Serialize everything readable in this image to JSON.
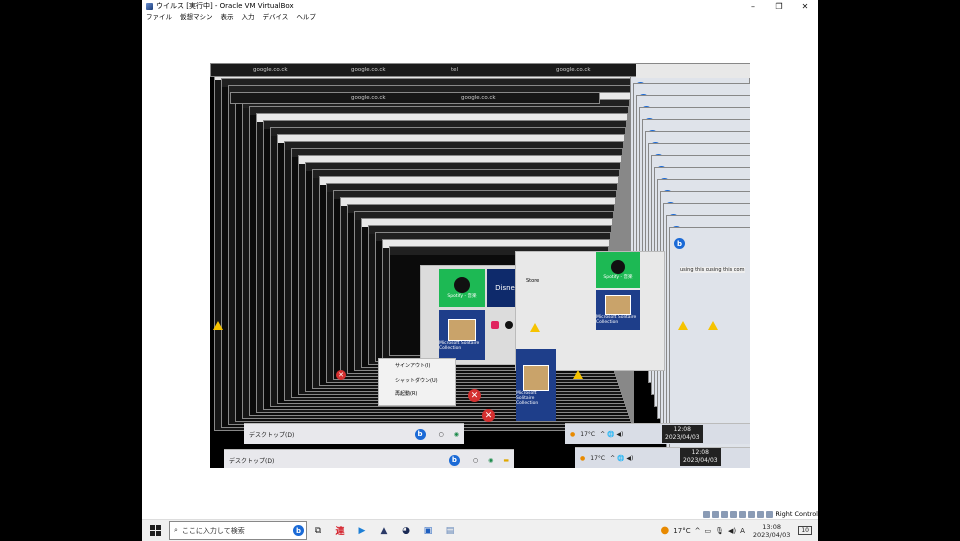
{
  "window": {
    "title": "ウイルス [実行中] - Oracle VM VirtualBox",
    "minimize_glyph": "–",
    "maximize_glyph": "❐",
    "close_glyph": "✕"
  },
  "menu": [
    "ファイル",
    "仮想マシン",
    "表示",
    "入力",
    "デバイス",
    "ヘルプ"
  ],
  "guest": {
    "tabs": [
      "google.co.ck",
      "google.co.ck",
      "google.co.ck",
      "google.co.ck",
      "google.co.ck",
      "tel"
    ],
    "start_tiles": [
      "Spotify - 音楽",
      "Disney+",
      "Microsoft Solitaire Collection"
    ],
    "menu_items": [
      "サインアウト(I)",
      "シャットダウン(U)",
      "再起動(R)"
    ],
    "desktop_label": "デスクトップ(D)",
    "store_text": "Store",
    "using_text": "using this com",
    "temperature": "17°C",
    "clock": [
      {
        "time": "12:08",
        "date": "2023/04/03"
      },
      {
        "time": "12:08",
        "date": "2023/04/03"
      }
    ]
  },
  "statusbar": {
    "host_key": "Right Control"
  },
  "taskbar": {
    "search_placeholder": "ここに入力して検索",
    "apps": [
      "bing-icon",
      "task-view-icon",
      "ren-app-icon",
      "media-player-icon",
      "atom-icon",
      "sphere-app-icon",
      "virtualbox-icon",
      "vbox-manager-icon"
    ],
    "ren_label": "連",
    "temperature": "17°C",
    "ime": "A",
    "time": "13:08",
    "date": "2023/04/03",
    "notification_count": "10"
  }
}
